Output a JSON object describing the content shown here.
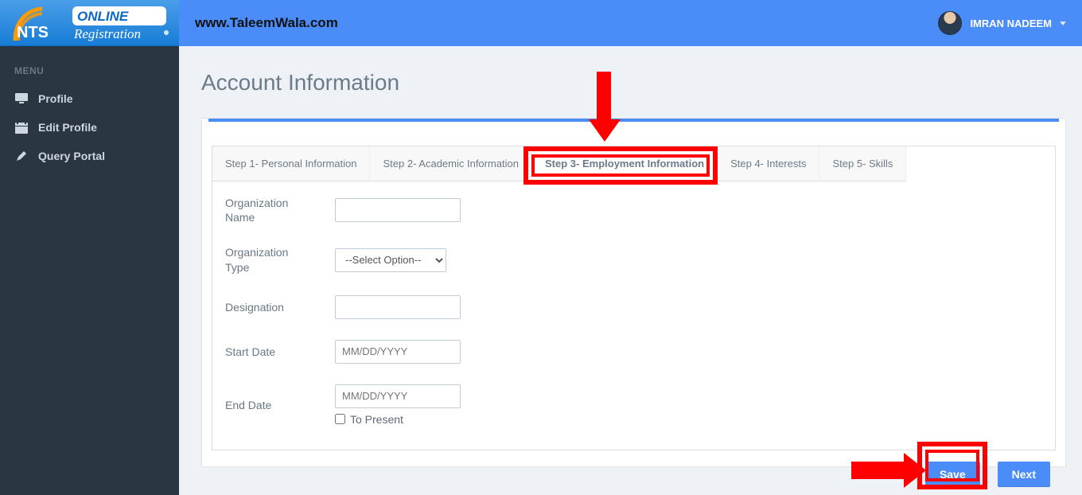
{
  "header": {
    "url_text": "www.TaleemWala.com",
    "user_name": "IMRAN NADEEM"
  },
  "sidebar": {
    "heading": "MENU",
    "items": [
      {
        "label": "Profile",
        "icon": "monitor-icon"
      },
      {
        "label": "Edit Profile",
        "icon": "calendar-icon"
      },
      {
        "label": "Query Portal",
        "icon": "pencil-icon"
      }
    ]
  },
  "page": {
    "title": "Account Information"
  },
  "tabs": [
    {
      "label": "Step 1- Personal Information"
    },
    {
      "label": "Step 2- Academic Information"
    },
    {
      "label": "Step 3- Employment Information",
      "active": true
    },
    {
      "label": "Step 4- Interests"
    },
    {
      "label": "Step 5- Skills"
    }
  ],
  "form": {
    "org_name_label": "Organization Name",
    "org_name_value": "",
    "org_type_label": "Organization Type",
    "org_type_selected": "--Select Option--",
    "designation_label": "Designation",
    "designation_value": "",
    "start_date_label": "Start Date",
    "start_date_placeholder": "MM/DD/YYYY",
    "end_date_label": "End Date",
    "end_date_placeholder": "MM/DD/YYYY",
    "to_present_label": "To Present"
  },
  "actions": {
    "save_label": "Save",
    "next_label": "Next"
  }
}
